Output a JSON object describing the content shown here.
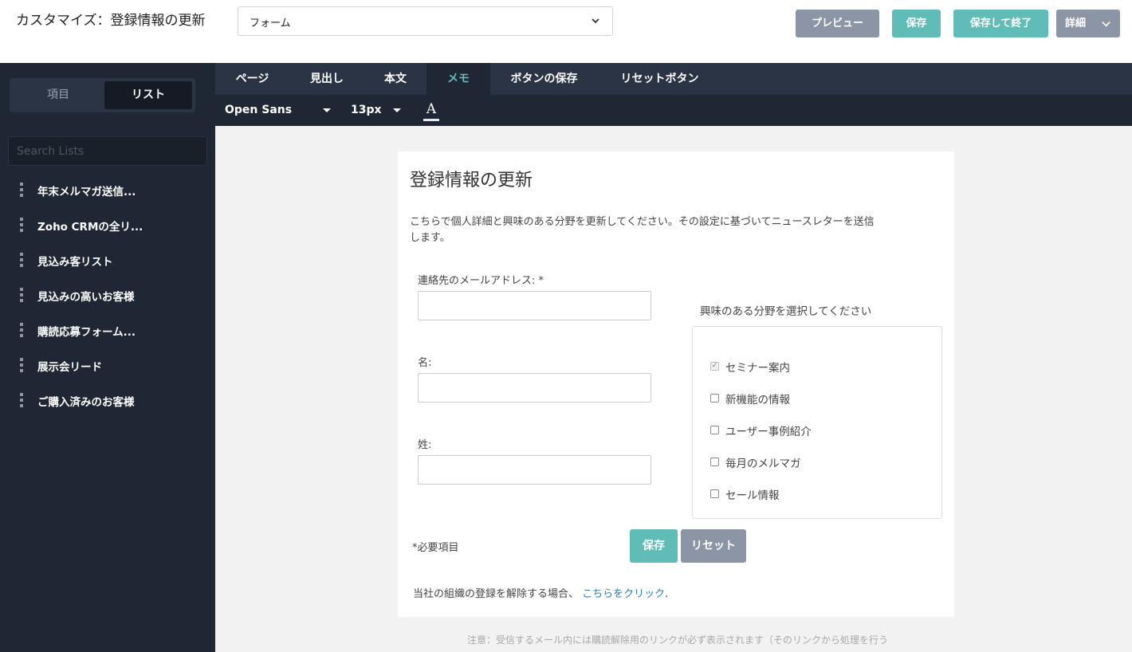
{
  "header": {
    "title": "カスタマイズ：登録情報の更新",
    "form_select_value": "フォーム",
    "preview_label": "プレビュー",
    "save_label": "保存",
    "save_exit_label": "保存して終了",
    "detail_label": "詳細"
  },
  "sidebar": {
    "tabs": [
      "項目",
      "リスト"
    ],
    "active_tab": "リスト",
    "search_placeholder": "Search Lists",
    "items": [
      "年末メルマガ送信...",
      "Zoho CRMの全リ...",
      "見込み客リスト",
      "見込みの高いお客様",
      "購読応募フォーム...",
      "展示会リード",
      "ご購入済みのお客様"
    ]
  },
  "editor": {
    "tabs": [
      "ページ",
      "見出し",
      "本文",
      "メモ",
      "ボタンの保存",
      "リセットボタン"
    ],
    "active_tab": "メモ",
    "font": "Open Sans",
    "size": "13px",
    "color_glyph": "A"
  },
  "form": {
    "title": "登録情報の更新",
    "description": "こちらで個人詳細と興味のある分野を更新してください。その設定に基づいてニュースレターを送信します。",
    "fields": [
      {
        "label": "連絡先のメールアドレス: *",
        "value": ""
      },
      {
        "label": "名:",
        "value": ""
      },
      {
        "label": "姓:",
        "value": ""
      }
    ],
    "interests_title": "興味のある分野を選択してください",
    "interests": [
      {
        "label": "セミナー案内",
        "checked": true
      },
      {
        "label": "新機能の情報",
        "checked": false
      },
      {
        "label": "ユーザー事例紹介",
        "checked": false
      },
      {
        "label": "毎月のメルマガ",
        "checked": false
      },
      {
        "label": "セール情報",
        "checked": false
      }
    ],
    "required_note": "*必要項目",
    "save_label": "保存",
    "reset_label": "リセット",
    "unsubscribe_text": "当社の組織の登録を解除する場合、",
    "unsubscribe_link": "こちらをクリック",
    "unsubscribe_end": "."
  },
  "footnote": "注意：受信するメール内には購読解除用のリンクが必ず表示されます（そのリンクから処理を行う",
  "colors": {
    "accent": "#5fbcb7",
    "secondary": "#8b95a5",
    "sidebar_bg": "#1f2734",
    "link": "#2e7fb6"
  }
}
